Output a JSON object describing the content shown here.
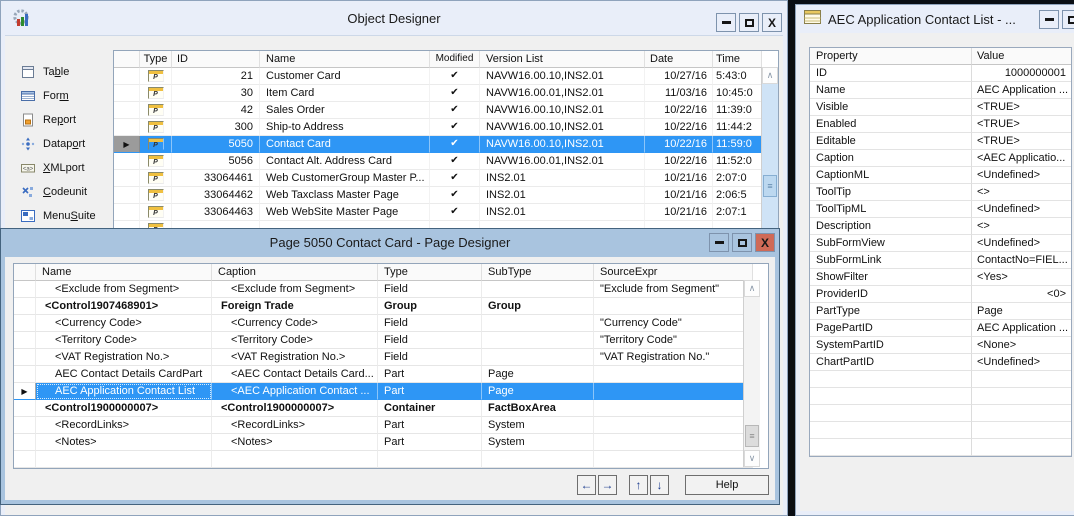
{
  "colors": {
    "selection": "#2e96f5",
    "active_titlebar": "#a9c4df",
    "inactive_titlebar": "#e9eef9",
    "active_close_button": "#cf6a57",
    "desktop_background": "#0a0e14"
  },
  "icons": {
    "row_selector": "▶",
    "check": "✔",
    "scroll_up": "∧",
    "scroll_down": "∨",
    "grip": "≡",
    "type_page_letter": "P"
  },
  "object_designer": {
    "title": "Object Designer",
    "sidebar_items": [
      {
        "pre": "Ta",
        "key": "b",
        "post": "le",
        "icon": "table-icon"
      },
      {
        "pre": "For",
        "key": "m",
        "post": "",
        "icon": "form-icon"
      },
      {
        "pre": "Re",
        "key": "p",
        "post": "ort",
        "icon": "report-icon"
      },
      {
        "pre": "Datap",
        "key": "o",
        "post": "rt",
        "icon": "dataport-icon"
      },
      {
        "pre": "",
        "key": "X",
        "post": "MLport",
        "icon": "xmlport-icon"
      },
      {
        "pre": "",
        "key": "C",
        "post": "odeunit",
        "icon": "codeunit-icon"
      },
      {
        "pre": "Menu",
        "key": "S",
        "post": "uite",
        "icon": "menusuite-icon"
      }
    ],
    "columns": [
      "Type",
      "ID",
      "Name",
      "Modified",
      "Version List",
      "Date",
      "Time"
    ],
    "rows": [
      {
        "id": "21",
        "name": "Customer Card",
        "modified": true,
        "version_list": "NAVW16.00.10,INS2.01",
        "date": "10/27/16",
        "time": "5:43:0"
      },
      {
        "id": "30",
        "name": "Item Card",
        "modified": true,
        "version_list": "NAVW16.00.01,INS2.01",
        "date": "11/03/16",
        "time": "10:45:0"
      },
      {
        "id": "42",
        "name": "Sales Order",
        "modified": true,
        "version_list": "NAVW16.00.10,INS2.01",
        "date": "10/22/16",
        "time": "11:39:0"
      },
      {
        "id": "300",
        "name": "Ship-to Address",
        "modified": true,
        "version_list": "NAVW16.00.10,INS2.01",
        "date": "10/22/16",
        "time": "11:44:2"
      },
      {
        "id": "5050",
        "name": "Contact Card",
        "modified": true,
        "version_list": "NAVW16.00.10,INS2.01",
        "date": "10/22/16",
        "time": "11:59:0",
        "selected": true
      },
      {
        "id": "5056",
        "name": "Contact Alt. Address Card",
        "modified": true,
        "version_list": "NAVW16.00.01,INS2.01",
        "date": "10/22/16",
        "time": "11:52:0"
      },
      {
        "id": "33064461",
        "name": "Web CustomerGroup Master P...",
        "modified": true,
        "version_list": "INS2.01",
        "date": "10/21/16",
        "time": "2:07:0"
      },
      {
        "id": "33064462",
        "name": "Web Taxclass Master Page",
        "modified": true,
        "version_list": "INS2.01",
        "date": "10/21/16",
        "time": "2:06:5"
      },
      {
        "id": "33064463",
        "name": "Web WebSite Master Page",
        "modified": true,
        "version_list": "INS2.01",
        "date": "10/21/16",
        "time": "2:07:1"
      },
      {
        "id": "",
        "name": "",
        "modified": false,
        "version_list": "",
        "date": "",
        "time": "",
        "partial": true
      }
    ]
  },
  "page_designer": {
    "title": "Page 5050 Contact Card - Page Designer",
    "columns": [
      "Name",
      "Caption",
      "Type",
      "SubType",
      "SourceExpr"
    ],
    "rows": [
      {
        "name": "<Exclude from Segment>",
        "caption": "<Exclude from Segment>",
        "type": "Field",
        "subtype": "",
        "source_expr": "\"Exclude from Segment\""
      },
      {
        "name": "<Control1907468901>",
        "caption": "Foreign Trade",
        "type": "Group",
        "subtype": "Group",
        "source_expr": "",
        "bold": true
      },
      {
        "name": "<Currency Code>",
        "caption": "<Currency Code>",
        "type": "Field",
        "subtype": "",
        "source_expr": "\"Currency Code\""
      },
      {
        "name": "<Territory Code>",
        "caption": "<Territory Code>",
        "type": "Field",
        "subtype": "",
        "source_expr": "\"Territory Code\""
      },
      {
        "name": "<VAT Registration No.>",
        "caption": "<VAT Registration No.>",
        "type": "Field",
        "subtype": "",
        "source_expr": "\"VAT Registration No.\""
      },
      {
        "name": "AEC Contact Details CardPart",
        "caption": "<AEC Contact Details Card...",
        "type": "Part",
        "subtype": "Page",
        "source_expr": ""
      },
      {
        "name": "AEC Application Contact List",
        "caption": "<AEC Application Contact ...",
        "type": "Part",
        "subtype": "Page",
        "source_expr": "",
        "selected": true
      },
      {
        "name": "<Control1900000007>",
        "caption": "<Control1900000007>",
        "type": "Container",
        "subtype": "FactBoxArea",
        "source_expr": "",
        "bold": true
      },
      {
        "name": "<RecordLinks>",
        "caption": "<RecordLinks>",
        "type": "Part",
        "subtype": "System",
        "source_expr": ""
      },
      {
        "name": "<Notes>",
        "caption": "<Notes>",
        "type": "Part",
        "subtype": "System",
        "source_expr": ""
      },
      {
        "name": "",
        "caption": "",
        "type": "",
        "subtype": "",
        "source_expr": "",
        "empty": true
      }
    ],
    "footer_buttons": {
      "left": "←",
      "right": "→",
      "up": "↑",
      "down": "↓",
      "help": "Help"
    }
  },
  "properties_window": {
    "title": "AEC Application Contact List - ...",
    "columns": [
      "Property",
      "Value"
    ],
    "rows": [
      {
        "property": "ID",
        "value": "1000000001",
        "align": "right"
      },
      {
        "property": "Name",
        "value": "AEC Application ..."
      },
      {
        "property": "Visible",
        "value": "<TRUE>"
      },
      {
        "property": "Enabled",
        "value": "<TRUE>"
      },
      {
        "property": "Editable",
        "value": "<TRUE>"
      },
      {
        "property": "Caption",
        "value": "<AEC Applicatio..."
      },
      {
        "property": "CaptionML",
        "value": "<Undefined>"
      },
      {
        "property": "ToolTip",
        "value": "<>"
      },
      {
        "property": "ToolTipML",
        "value": "<Undefined>"
      },
      {
        "property": "Description",
        "value": "<>"
      },
      {
        "property": "SubFormView",
        "value": "<Undefined>"
      },
      {
        "property": "SubFormLink",
        "value": "ContactNo=FIEL..."
      },
      {
        "property": "ShowFilter",
        "value": "<Yes>"
      },
      {
        "property": "ProviderID",
        "value": "<0>",
        "align": "right"
      },
      {
        "property": "PartType",
        "value": "Page"
      },
      {
        "property": "PagePartID",
        "value": "AEC Application ..."
      },
      {
        "property": "SystemPartID",
        "value": "<None>"
      },
      {
        "property": "ChartPartID",
        "value": "<Undefined>"
      }
    ]
  }
}
